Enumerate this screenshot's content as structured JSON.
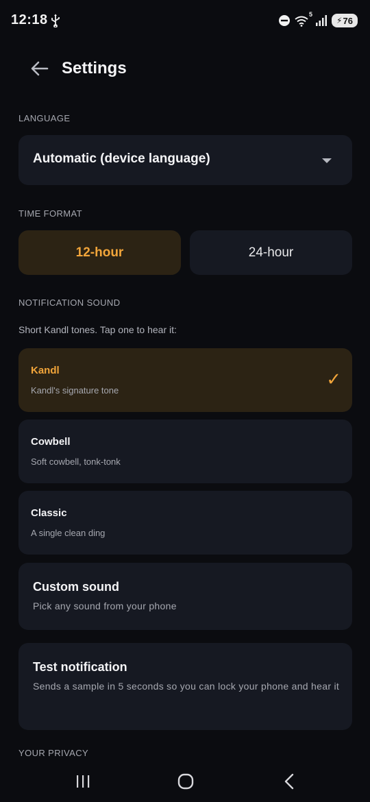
{
  "status_bar": {
    "time": "12:18",
    "battery_level": "76",
    "wifi_badge": "5",
    "icons": [
      "usb-icon",
      "dnd-icon",
      "wifi-icon",
      "signal-icon",
      "battery-charging-icon"
    ]
  },
  "header": {
    "title": "Settings",
    "back_icon": "arrow-left-icon"
  },
  "language": {
    "section_label": "LANGUAGE",
    "selected": "Automatic (device language)"
  },
  "time_format": {
    "section_label": "TIME FORMAT",
    "options": [
      "12-hour",
      "24-hour"
    ],
    "selected": "12-hour"
  },
  "notification_sound": {
    "section_label": "NOTIFICATION SOUND",
    "helper": "Short Kandl tones. Tap one to hear it:",
    "tones": [
      {
        "name": "Kandl",
        "description": "Kandl's signature tone",
        "selected": true
      },
      {
        "name": "Cowbell",
        "description": "Soft cowbell, tonk-tonk",
        "selected": false
      },
      {
        "name": "Classic",
        "description": "A single clean ding",
        "selected": false
      }
    ],
    "custom": {
      "title": "Custom sound",
      "description": "Pick any sound from your phone"
    },
    "test": {
      "title": "Test notification",
      "description": "Sends a sample in 5 seconds so you can lock your phone and hear it"
    },
    "check_mark": "✓"
  },
  "privacy": {
    "section_label": "YOUR PRIVACY"
  },
  "colors": {
    "background": "#0b0c10",
    "card": "#161922",
    "selected_card": "#2c2314",
    "accent": "#f2a53a"
  }
}
